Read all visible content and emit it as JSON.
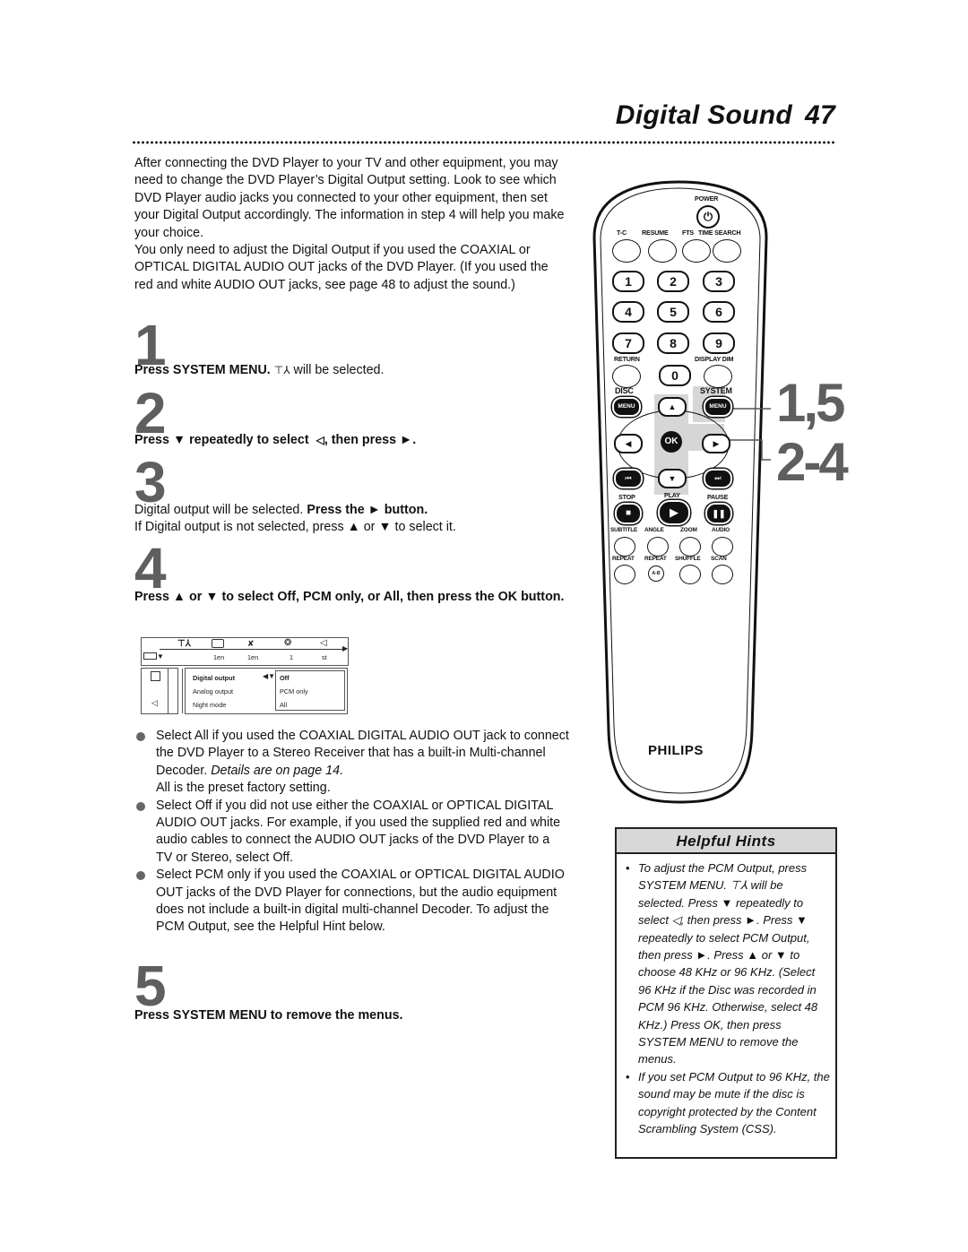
{
  "header": {
    "title": "Digital Sound",
    "page_number": "47"
  },
  "intro": {
    "paragraph1": "After connecting the DVD Player to your TV and other equipment, you may need to change the DVD Player’s Digital Output setting. Look to see which DVD Player audio jacks you connected to your other equipment, then set your Digital Output accordingly. The information in step 4 will help you make your choice.",
    "paragraph2": "You only need to adjust the Digital Output if you used the COAXIAL or OPTICAL DIGITAL AUDIO OUT jacks of the DVD Player. (If you used the red and white AUDIO OUT jacks, see page 48 to adjust the sound.)"
  },
  "steps": [
    {
      "number": "1",
      "bold": "Press SYSTEM MENU.",
      "icon": "system-setup-icon",
      "rest": "will be selected."
    },
    {
      "number": "2",
      "bold_a": "Press",
      "down": "▼",
      "bold_b": "repeatedly to select",
      "icon": "speaker-icon",
      "bold_c": ", then press",
      "right": "►",
      "end": "."
    },
    {
      "number": "3",
      "line1_plain": "Digital output will be selected.",
      "line1_bold": "Press the ► button.",
      "line2": "If Digital output is not selected, press ▲ or ▼ to select it."
    },
    {
      "number": "4",
      "bold": "Press ▲ or ▼ to select Off, PCM only, or All, then press the OK button."
    },
    {
      "number": "5",
      "bold": "Press SYSTEM MENU to remove the menus."
    }
  ],
  "osd": {
    "top_values": [
      "1en",
      "1en",
      "1",
      "st"
    ],
    "menu_items": [
      "Digital output",
      "Analog output",
      "Night mode"
    ],
    "options": [
      "Off",
      "PCM only",
      "All"
    ],
    "selected_option": "Off"
  },
  "bullets": [
    {
      "text": "Select All if you used the COAXIAL DIGITAL AUDIO OUT jack to connect the DVD Player to a Stereo Receiver that has a built-in Multi-channel Decoder.",
      "italic": "Details are on page 14.",
      "extra": "All is the preset factory setting."
    },
    {
      "text": "Select Off if you did not use either the COAXIAL or OPTICAL DIGITAL AUDIO OUT jacks. For example, if you used the supplied red and white audio cables to connect the AUDIO OUT jacks of the DVD Player to a TV or Stereo, select Off."
    },
    {
      "text": "Select PCM only if you used the COAXIAL or OPTICAL DIGITAL AUDIO OUT jacks of the DVD Player for connections, but the audio equipment does not include a built-in digital multi-channel Decoder. To adjust the PCM Output, see the Helpful Hint below."
    }
  ],
  "remote": {
    "labels": {
      "power": "POWER",
      "tc": "T-C",
      "resume": "RESUME",
      "fts": "FTS",
      "time_search": "TIME SEARCH",
      "return": "RETURN",
      "display_dim": "DISPLAY DIM",
      "disc": "DISC",
      "system": "SYSTEM",
      "menu": "MENU",
      "ok": "OK",
      "stop": "STOP",
      "play": "PLAY",
      "pause": "PAUSE",
      "subtitle": "SUBTITLE",
      "angle": "ANGLE",
      "zoom": "ZOOM",
      "audio": "AUDIO",
      "repeat": "REPEAT",
      "repeat_ab": "REPEAT",
      "ab": "A-B",
      "shuffle": "SHUFFLE",
      "scan": "SCAN",
      "brand": "PHILIPS"
    },
    "digits": [
      "1",
      "2",
      "3",
      "4",
      "5",
      "6",
      "7",
      "8",
      "9",
      "0"
    ],
    "callouts": [
      "1,5",
      "2-4"
    ]
  },
  "hints": {
    "title": "Helpful Hints",
    "items": [
      "To adjust the PCM Output, press SYSTEM MENU. ⊤⅄ will be selected. Press ▼ repeatedly to select ◁, then press ►. Press ▼ repeatedly to select PCM Output, then press ►. Press ▲ or ▼ to choose 48 KHz or 96 KHz. (Select 96 KHz if the Disc was recorded in PCM 96 KHz. Otherwise, select 48 KHz.) Press OK, then press SYSTEM MENU to remove the menus.",
      "If you set PCM Output to 96 KHz, the sound may be mute if the disc is copyright protected by the Content Scrambling System (CSS)."
    ]
  }
}
